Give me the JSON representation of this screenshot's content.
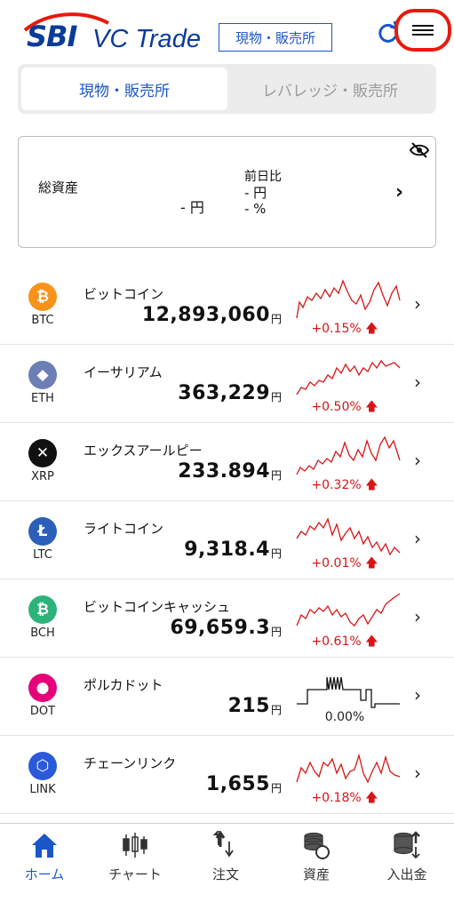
{
  "header": {
    "logo_sbi": "SBI",
    "logo_product": "VC Trade",
    "mode_badge": "現物・販売所"
  },
  "tabs": [
    {
      "label": "現物・販売所",
      "active": true
    },
    {
      "label": "レバレッジ・販売所",
      "active": false
    }
  ],
  "asset_summary": {
    "total_label": "総資産",
    "total_value": "- 円",
    "prev_label": "前日比",
    "prev_yen": "- 円",
    "prev_pct": "- %"
  },
  "coins": [
    {
      "name": "ビットコイン",
      "symbol": "BTC",
      "price": "12,893,060",
      "unit": "円",
      "change": "+0.15%",
      "color": "#f7931a",
      "glyph": "₿",
      "trend": "up"
    },
    {
      "name": "イーサリアム",
      "symbol": "ETH",
      "price": "363,229",
      "unit": "円",
      "change": "+0.50%",
      "color": "#6b7fb5",
      "glyph": "◆",
      "trend": "up"
    },
    {
      "name": "エックスアールピー",
      "symbol": "XRP",
      "price": "233.894",
      "unit": "円",
      "change": "+0.32%",
      "color": "#111111",
      "glyph": "✕",
      "trend": "up"
    },
    {
      "name": "ライトコイン",
      "symbol": "LTC",
      "price": "9,318.4",
      "unit": "円",
      "change": "+0.01%",
      "color": "#2b5fb8",
      "glyph": "Ł",
      "trend": "up"
    },
    {
      "name": "ビットコインキャッシュ",
      "symbol": "BCH",
      "price": "69,659.3",
      "unit": "円",
      "change": "+0.61%",
      "color": "#2cb37a",
      "glyph": "₿",
      "trend": "up"
    },
    {
      "name": "ポルカドット",
      "symbol": "DOT",
      "price": "215",
      "unit": "円",
      "change": "0.00%",
      "color": "#e6007a",
      "glyph": "●",
      "trend": "flat"
    },
    {
      "name": "チェーンリンク",
      "symbol": "LINK",
      "price": "1,655",
      "unit": "円",
      "change": "+0.18%",
      "color": "#2a5ada",
      "glyph": "⬡",
      "trend": "up"
    }
  ],
  "nav": [
    {
      "label": "ホーム",
      "icon": "home-icon",
      "active": true
    },
    {
      "label": "チャート",
      "icon": "candlestick-chart-icon",
      "active": false
    },
    {
      "label": "注文",
      "icon": "order-icon",
      "active": false
    },
    {
      "label": "資産",
      "icon": "coins-icon",
      "active": false
    },
    {
      "label": "入出金",
      "icon": "deposit-withdraw-icon",
      "active": false
    }
  ],
  "colors": {
    "accent": "#1a56c8",
    "positive": "#d81515",
    "highlight_ring": "#e8190d"
  }
}
